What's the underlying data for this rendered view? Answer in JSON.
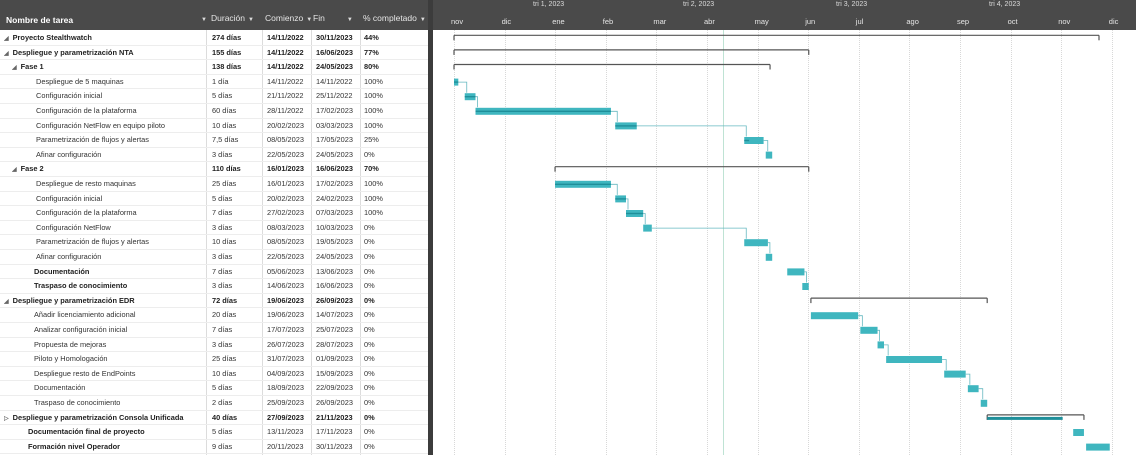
{
  "headers": {
    "name": "Nombre de tarea",
    "duration": "Duración",
    "start": "Comienzo",
    "end": "Fin",
    "complete": "% completado"
  },
  "timeline": {
    "quarters": [
      "tri 1, 2023",
      "tri 2, 2023",
      "tri 3, 2023",
      "tri 4, 2023"
    ],
    "months": [
      "nov",
      "dic",
      "ene",
      "feb",
      "mar",
      "abr",
      "may",
      "jun",
      "jul",
      "ago",
      "sep",
      "oct",
      "nov",
      "dic"
    ]
  },
  "colors": {
    "bar": "#3fb6bf",
    "bar_progress": "#1f8f9a",
    "summary": "#555555",
    "link": "#66b8c0",
    "header_bg": "#4a4a4a"
  },
  "tasks": [
    {
      "name": "Proyecto Stealthwatch",
      "duration": "274 días",
      "start": "14/11/2022",
      "end": "30/11/2023",
      "complete": "44%",
      "level": 0,
      "summary": true,
      "toggle": "◢",
      "bar": "summary",
      "s": 0,
      "e": 30
    },
    {
      "name": "Despliegue y parametrización NTA",
      "duration": "155 días",
      "start": "14/11/2022",
      "end": "16/06/2023",
      "complete": "77%",
      "level": 1,
      "summary": true,
      "toggle": "◢",
      "bar": "summary",
      "s": 0,
      "e": 16.5
    },
    {
      "name": "Fase 1",
      "duration": "138 días",
      "start": "14/11/2022",
      "end": "24/05/2023",
      "complete": "80%",
      "level": 2,
      "summary": true,
      "toggle": "◢",
      "bar": "summary",
      "s": 0,
      "e": 14.7
    },
    {
      "name": "Despliegue de 5 maquinas",
      "duration": "1 día",
      "start": "14/11/2022",
      "end": "14/11/2022",
      "complete": "100%",
      "level": 3,
      "summary": false,
      "bar": "task",
      "s": 0,
      "e": 0.2,
      "p": 1
    },
    {
      "name": "Configuración inicial",
      "duration": "5 días",
      "start": "21/11/2022",
      "end": "25/11/2022",
      "complete": "100%",
      "level": 3,
      "summary": false,
      "bar": "task",
      "s": 0.5,
      "e": 1,
      "p": 1
    },
    {
      "name": "Configuración de la plataforma",
      "duration": "60 días",
      "start": "28/11/2022",
      "end": "17/02/2023",
      "complete": "100%",
      "level": 3,
      "summary": false,
      "bar": "task",
      "s": 1,
      "e": 7.3,
      "p": 1
    },
    {
      "name": "Configuración NetFlow en equipo piloto",
      "duration": "10 días",
      "start": "20/02/2023",
      "end": "03/03/2023",
      "complete": "100%",
      "level": 3,
      "summary": false,
      "bar": "task",
      "s": 7.5,
      "e": 8.5,
      "p": 1
    },
    {
      "name": "Parametrización de flujos y alertas",
      "duration": "7,5 días",
      "start": "08/05/2023",
      "end": "17/05/2023",
      "complete": "25%",
      "level": 3,
      "summary": false,
      "bar": "task",
      "s": 13.5,
      "e": 14.4,
      "p": 0.25
    },
    {
      "name": "Afinar configuración",
      "duration": "3 días",
      "start": "22/05/2023",
      "end": "24/05/2023",
      "complete": "0%",
      "level": 3,
      "summary": false,
      "bar": "task",
      "s": 14.5,
      "e": 14.8,
      "p": 0
    },
    {
      "name": "Fase 2",
      "duration": "110 días",
      "start": "16/01/2023",
      "end": "16/06/2023",
      "complete": "70%",
      "level": 2,
      "summary": true,
      "toggle": "◢",
      "bar": "summary",
      "s": 4.7,
      "e": 16.5
    },
    {
      "name": "Despliegue de resto maquinas",
      "duration": "25 días",
      "start": "16/01/2023",
      "end": "17/02/2023",
      "complete": "100%",
      "level": 3,
      "summary": false,
      "bar": "task",
      "s": 4.7,
      "e": 7.3,
      "p": 1
    },
    {
      "name": "Configuración inicial",
      "duration": "5 días",
      "start": "20/02/2023",
      "end": "24/02/2023",
      "complete": "100%",
      "level": 3,
      "summary": false,
      "bar": "task",
      "s": 7.5,
      "e": 8,
      "p": 1
    },
    {
      "name": "Configuración de la plataforma",
      "duration": "7 días",
      "start": "27/02/2023",
      "end": "07/03/2023",
      "complete": "100%",
      "level": 3,
      "summary": false,
      "bar": "task",
      "s": 8,
      "e": 8.8,
      "p": 1
    },
    {
      "name": "Configuración NetFlow",
      "duration": "3 días",
      "start": "08/03/2023",
      "end": "10/03/2023",
      "complete": "0%",
      "level": 3,
      "summary": false,
      "bar": "task",
      "s": 8.8,
      "e": 9.2,
      "p": 0
    },
    {
      "name": "Parametrización de flujos y alertas",
      "duration": "10 días",
      "start": "08/05/2023",
      "end": "19/05/2023",
      "complete": "0%",
      "level": 3,
      "summary": false,
      "bar": "task",
      "s": 13.5,
      "e": 14.6,
      "p": 0
    },
    {
      "name": "Afinar configuración",
      "duration": "3 días",
      "start": "22/05/2023",
      "end": "24/05/2023",
      "complete": "0%",
      "level": 3,
      "summary": false,
      "bar": "task",
      "s": 14.5,
      "e": 14.8,
      "p": 0
    },
    {
      "name": "Documentación",
      "duration": "7 días",
      "start": "05/06/2023",
      "end": "13/06/2023",
      "complete": "0%",
      "level": 2,
      "summary": false,
      "boldName": true,
      "bar": "task",
      "s": 15.5,
      "e": 16.3,
      "p": 0
    },
    {
      "name": "Traspaso de conocimiento",
      "duration": "3 días",
      "start": "14/06/2023",
      "end": "16/06/2023",
      "complete": "0%",
      "level": 2,
      "summary": false,
      "boldName": true,
      "bar": "task",
      "s": 16.2,
      "e": 16.5,
      "p": 0
    },
    {
      "name": "Despliegue y parametrización EDR",
      "duration": "72 días",
      "start": "19/06/2023",
      "end": "26/09/2023",
      "complete": "0%",
      "level": 1,
      "summary": true,
      "toggle": "◢",
      "bar": "summary",
      "s": 16.6,
      "e": 24.8
    },
    {
      "name": "Añadir licenciamiento adicional",
      "duration": "20 días",
      "start": "19/06/2023",
      "end": "14/07/2023",
      "complete": "0%",
      "level": 2,
      "summary": false,
      "bar": "task",
      "s": 16.6,
      "e": 18.8,
      "p": 0
    },
    {
      "name": "Analizar configuración inicial",
      "duration": "7 días",
      "start": "17/07/2023",
      "end": "25/07/2023",
      "complete": "0%",
      "level": 2,
      "summary": false,
      "bar": "task",
      "s": 18.9,
      "e": 19.7,
      "p": 0
    },
    {
      "name": "Propuesta de mejoras",
      "duration": "3 días",
      "start": "26/07/2023",
      "end": "28/07/2023",
      "complete": "0%",
      "level": 2,
      "summary": false,
      "bar": "task",
      "s": 19.7,
      "e": 20,
      "p": 0
    },
    {
      "name": "Piloto y Homologación",
      "duration": "25 días",
      "start": "31/07/2023",
      "end": "01/09/2023",
      "complete": "0%",
      "level": 2,
      "summary": false,
      "bar": "task",
      "s": 20.1,
      "e": 22.7,
      "p": 0
    },
    {
      "name": "Despliegue resto de EndPoints",
      "duration": "10 días",
      "start": "04/09/2023",
      "end": "15/09/2023",
      "complete": "0%",
      "level": 2,
      "summary": false,
      "bar": "task",
      "s": 22.8,
      "e": 23.8,
      "p": 0
    },
    {
      "name": "Documentación",
      "duration": "5 días",
      "start": "18/09/2023",
      "end": "22/09/2023",
      "complete": "0%",
      "level": 2,
      "summary": false,
      "bar": "task",
      "s": 23.9,
      "e": 24.4,
      "p": 0
    },
    {
      "name": "Traspaso de conocimiento",
      "duration": "2 días",
      "start": "25/09/2023",
      "end": "26/09/2023",
      "complete": "0%",
      "level": 2,
      "summary": false,
      "bar": "task",
      "s": 24.5,
      "e": 24.8,
      "p": 0
    },
    {
      "name": "Despliegue y parametrización Consola Unificada",
      "duration": "40 días",
      "start": "27/09/2023",
      "end": "21/11/2023",
      "complete": "0%",
      "level": 1,
      "summary": true,
      "toggle": "▷",
      "bar": "summary",
      "s": 24.8,
      "e": 29.3
    },
    {
      "name": "Documentación final de proyecto",
      "duration": "5 días",
      "start": "13/11/2023",
      "end": "17/11/2023",
      "complete": "0%",
      "level": 1,
      "summary": false,
      "boldName": true,
      "bar": "task",
      "s": 28.8,
      "e": 29.3,
      "p": 0
    },
    {
      "name": "Formación nivel Operador",
      "duration": "9 días",
      "start": "20/11/2023",
      "end": "30/11/2023",
      "complete": "0%",
      "level": 1,
      "summary": false,
      "boldName": true,
      "bar": "task",
      "s": 29.4,
      "e": 30.5,
      "p": 0
    }
  ]
}
